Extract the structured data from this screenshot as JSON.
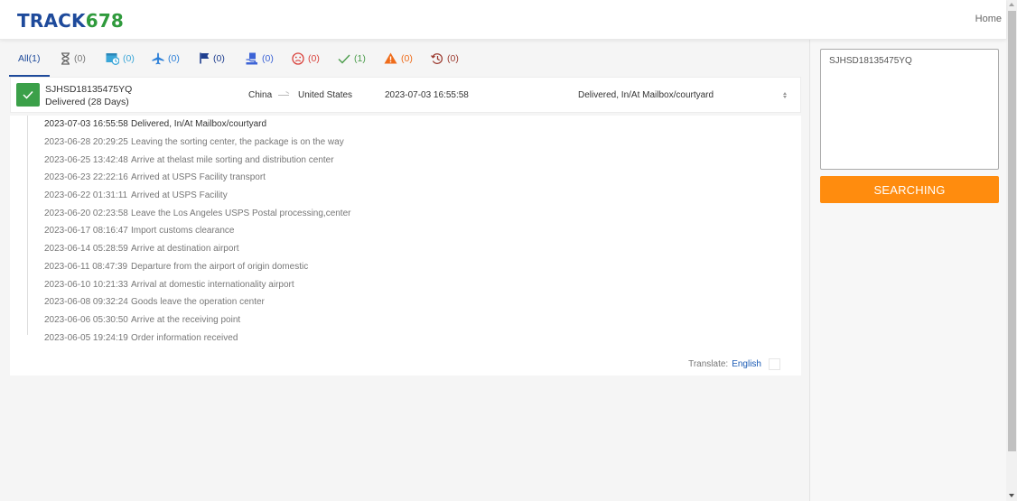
{
  "header": {
    "logo_part1": "TRACK",
    "logo_part2": "678",
    "home_link": "Home"
  },
  "tabs": [
    {
      "label": "All",
      "count": "(1)",
      "icon": "none",
      "color": "#1e4a9b",
      "active": true
    },
    {
      "label": "",
      "count": "(0)",
      "icon": "hourglass-icon",
      "color": "#777777"
    },
    {
      "label": "",
      "count": "(0)",
      "icon": "pickup-clock-icon",
      "color": "#3aa6d8"
    },
    {
      "label": "",
      "count": "(0)",
      "icon": "airplane-icon",
      "color": "#2b7fd8"
    },
    {
      "label": "",
      "count": "(0)",
      "icon": "flag-icon",
      "color": "#1f3f8f"
    },
    {
      "label": "",
      "count": "(0)",
      "icon": "delivery-hand-icon",
      "color": "#3c63d6"
    },
    {
      "label": "",
      "count": "(0)",
      "icon": "sad-face-icon",
      "color": "#d9413b"
    },
    {
      "label": "",
      "count": "(1)",
      "icon": "checkmark-icon",
      "color": "#4a9c4a"
    },
    {
      "label": "",
      "count": "(0)",
      "icon": "warning-icon",
      "color": "#ef6c1a"
    },
    {
      "label": "",
      "count": "(0)",
      "icon": "history-icon",
      "color": "#9c3a2f"
    }
  ],
  "shipment": {
    "tracking_number": "SJHSD18135475YQ",
    "status": "Delivered (28 Days)",
    "origin": "China",
    "destination": "United States",
    "latest_time": "2023-07-03 16:55:58",
    "latest_event": "Delivered, In/At Mailbox/courtyard",
    "status_color": "#3ba049"
  },
  "events": [
    {
      "time": "2023-07-03 16:55:58",
      "desc": "Delivered, In/At Mailbox/courtyard"
    },
    {
      "time": "2023-06-28 20:29:25",
      "desc": "Leaving the sorting center, the package is on the way"
    },
    {
      "time": "2023-06-25 13:42:48",
      "desc": "Arrive at thelast mile sorting and distribution center"
    },
    {
      "time": "2023-06-23 22:22:16",
      "desc": "Arrived at USPS Facility transport"
    },
    {
      "time": "2023-06-22 01:31:11",
      "desc": "Arrived at USPS Facility"
    },
    {
      "time": "2023-06-20 02:23:58",
      "desc": "Leave the Los Angeles USPS Postal processing,center"
    },
    {
      "time": "2023-06-17 08:16:47",
      "desc": "Import customs clearance"
    },
    {
      "time": "2023-06-14 05:28:59",
      "desc": "Arrive at destination airport"
    },
    {
      "time": "2023-06-11 08:47:39",
      "desc": "Departure from the airport of origin domestic"
    },
    {
      "time": "2023-06-10 10:21:33",
      "desc": "Arrival at domestic internationality airport"
    },
    {
      "time": "2023-06-08 09:32:24",
      "desc": "Goods leave the operation center"
    },
    {
      "time": "2023-06-06 05:30:50",
      "desc": "Arrive at the receiving point"
    },
    {
      "time": "2023-06-05 19:24:19",
      "desc": "Order information received"
    }
  ],
  "translate": {
    "label": "Translate:",
    "language": "English"
  },
  "sidebar": {
    "search_value": "SJHSD18135475YQ",
    "search_button": "SEARCHING",
    "button_color": "#ff8c0e"
  }
}
